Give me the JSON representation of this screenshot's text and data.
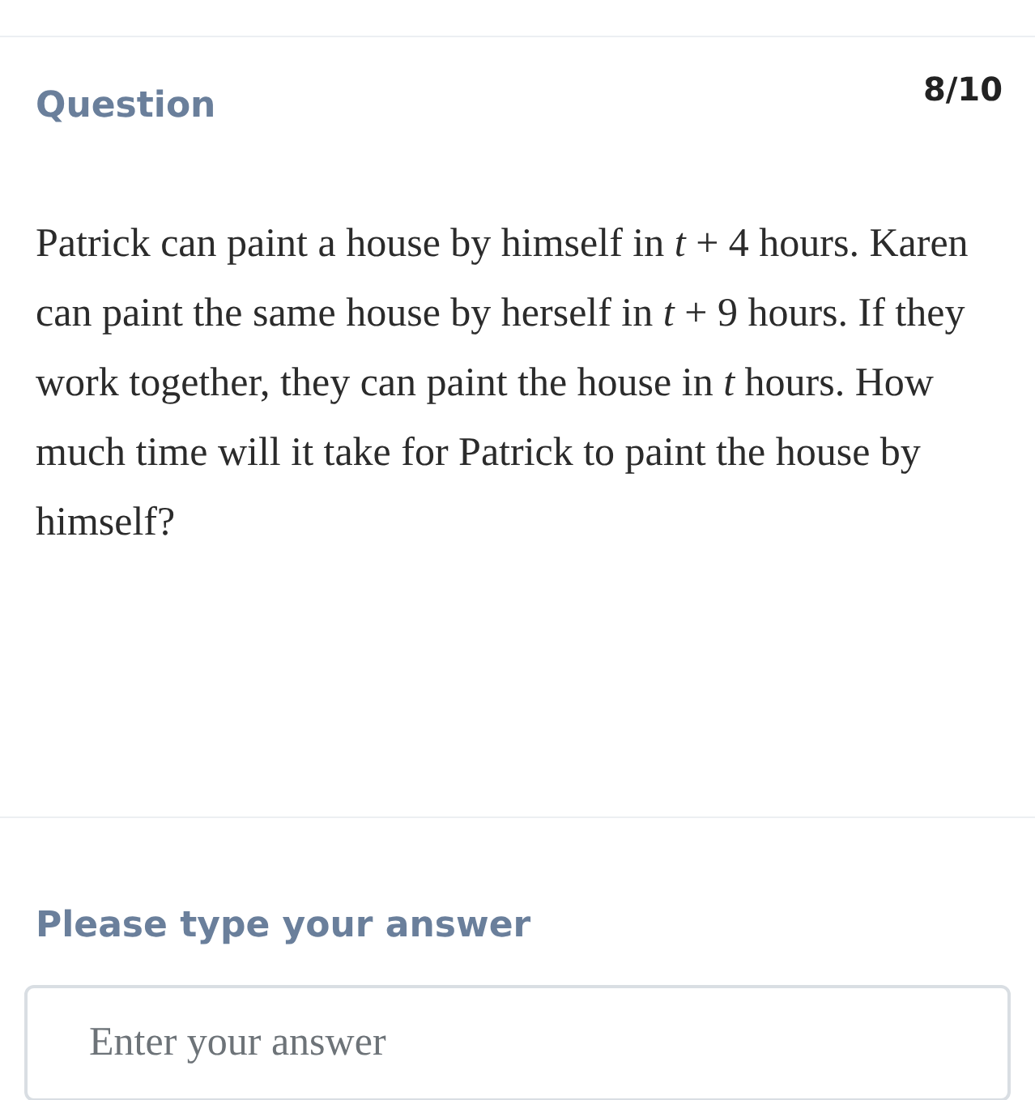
{
  "header": {
    "label": "Question",
    "progress": "8/10"
  },
  "question": {
    "text": "Patrick can paint a house by himself in *t* + 4 hours. Karen can paint the same house by herself in *t* + 9 hours. If they work together, they can paint the house in *t* hours. How much time will it take for Patrick to paint the house by himself?"
  },
  "answer": {
    "prompt": "Please type your answer",
    "placeholder": "Enter your answer"
  }
}
